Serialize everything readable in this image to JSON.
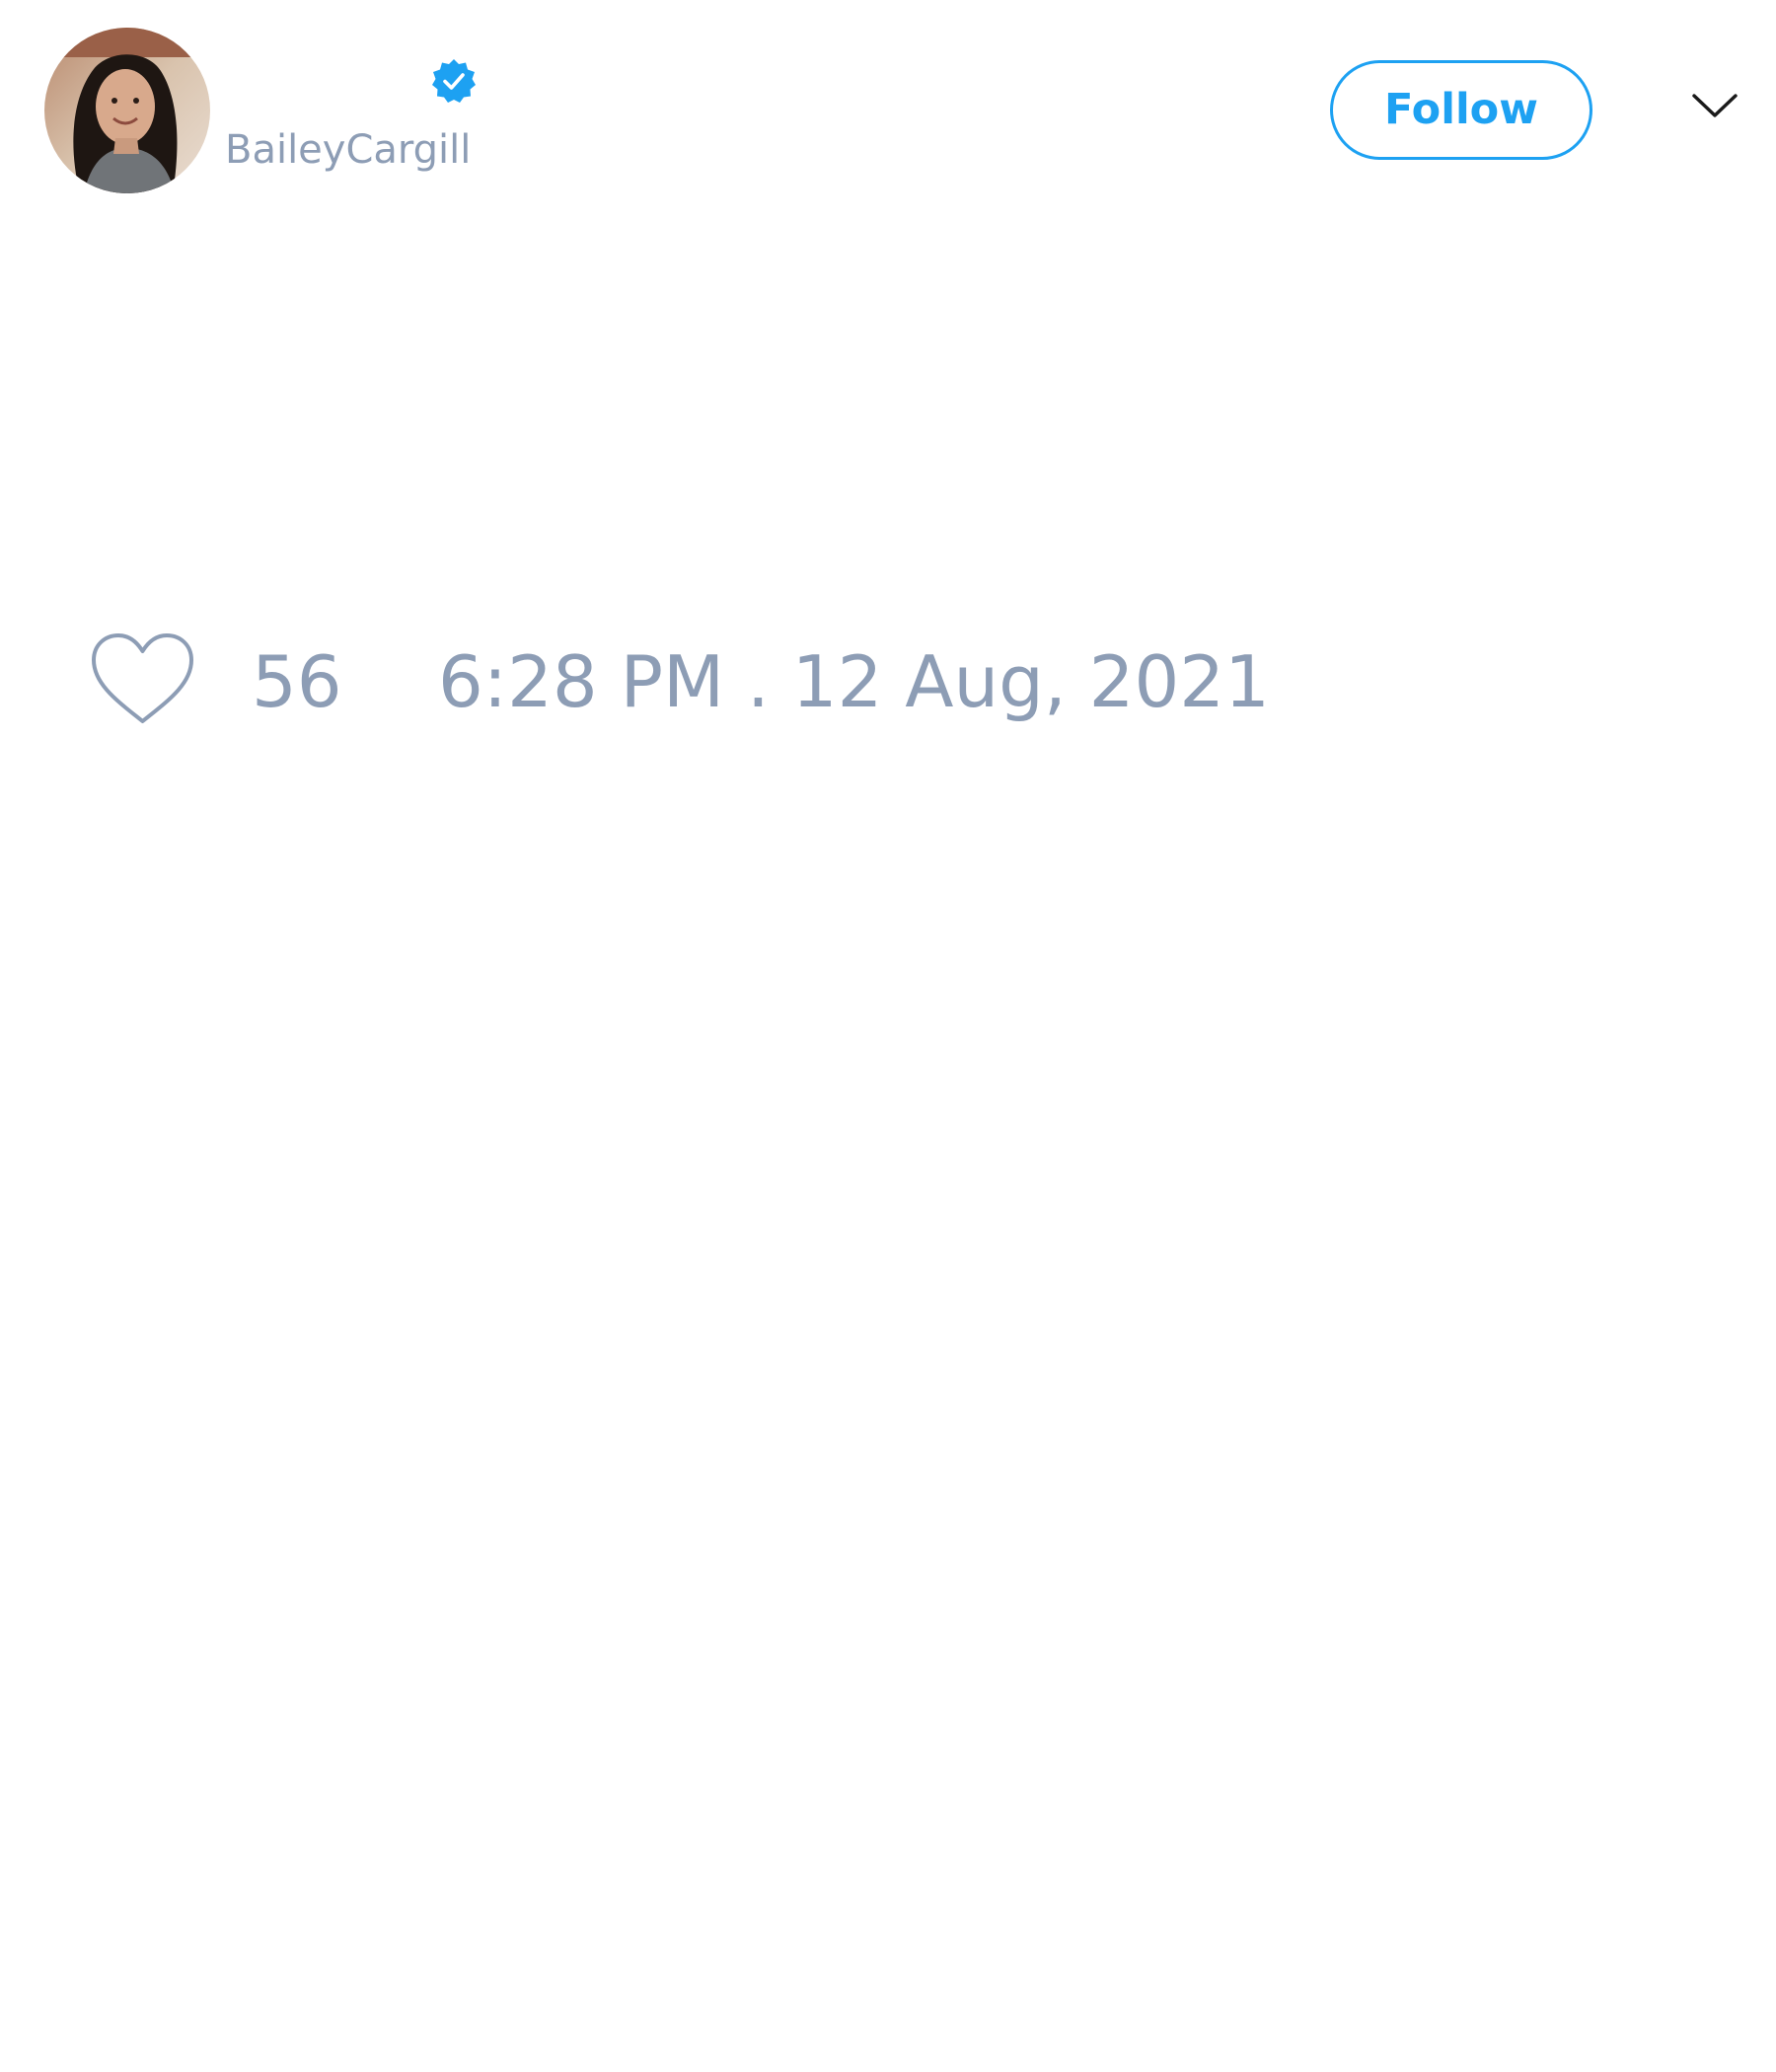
{
  "header": {
    "display_name": "",
    "handle": "BaileyCargill",
    "follow_label": "Follow",
    "verified_icon": "verified-badge-icon",
    "menu_icon": "chevron-down-icon"
  },
  "tweet": {
    "like_icon": "heart-outline-icon",
    "like_count": "56",
    "timestamp": "6:28 PM . 12 Aug, 2021"
  },
  "colors": {
    "accent": "#1da1f2",
    "muted_text": "#8d9db5",
    "background": "#ffffff"
  }
}
